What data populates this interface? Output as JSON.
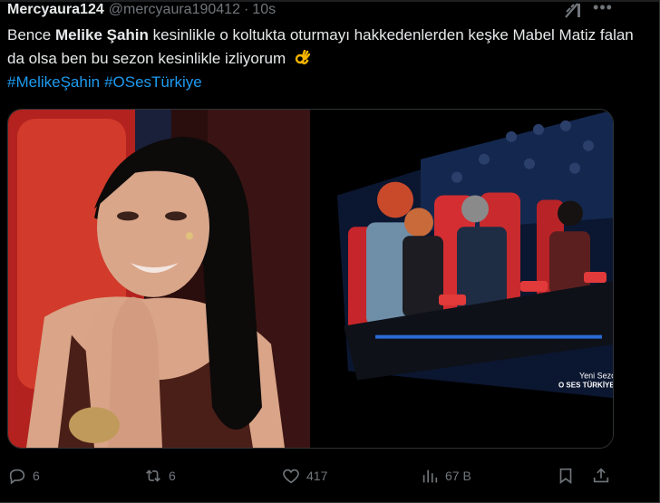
{
  "tweet": {
    "author": "Mercyaura124",
    "handle": "@mercyaura190412",
    "separator": "·",
    "time": "10s",
    "text_parts": [
      "Bence ",
      "Melike Şahin",
      " kesinlikle o koltukta oturmayı hakkedenlerden keşke Mabel Matiz falan da olsa ben bu sezon kesinlikle izliyorum"
    ],
    "emoji": "ok-hand-emoji",
    "hashtags": [
      "#MelikeŞahin",
      "#OSesTürkiye"
    ]
  },
  "media": {
    "right_overlay_line1": "Yeni Sezon",
    "right_overlay_line2": "O SES TÜRKİYE"
  },
  "actions": {
    "replies": "6",
    "reposts": "6",
    "likes": "417",
    "views": "67 B"
  },
  "colors": {
    "background": "#000000",
    "text": "#e7e9ea",
    "muted": "#71767b",
    "link": "#1d9bf0"
  }
}
